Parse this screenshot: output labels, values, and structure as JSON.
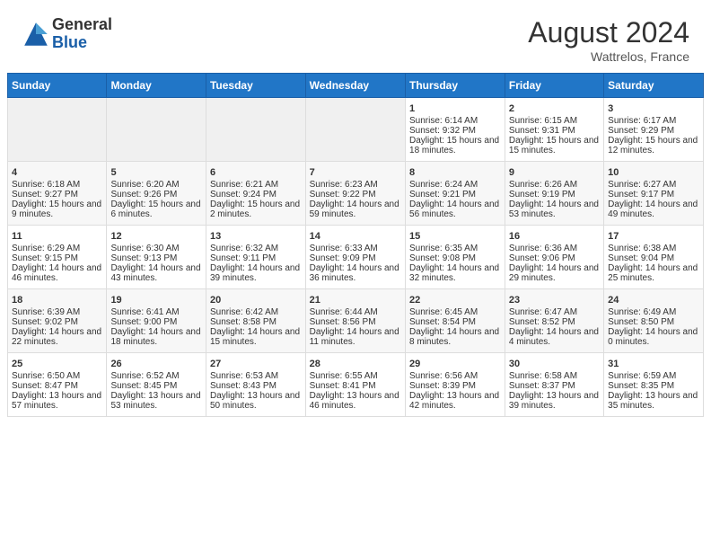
{
  "header": {
    "logo_general": "General",
    "logo_blue": "Blue",
    "month_year": "August 2024",
    "location": "Wattrelos, France"
  },
  "days_of_week": [
    "Sunday",
    "Monday",
    "Tuesday",
    "Wednesday",
    "Thursday",
    "Friday",
    "Saturday"
  ],
  "weeks": [
    [
      {
        "day": "",
        "empty": true
      },
      {
        "day": "",
        "empty": true
      },
      {
        "day": "",
        "empty": true
      },
      {
        "day": "",
        "empty": true
      },
      {
        "day": "1",
        "sunrise": "6:14 AM",
        "sunset": "9:32 PM",
        "daylight": "15 hours and 18 minutes."
      },
      {
        "day": "2",
        "sunrise": "6:15 AM",
        "sunset": "9:31 PM",
        "daylight": "15 hours and 15 minutes."
      },
      {
        "day": "3",
        "sunrise": "6:17 AM",
        "sunset": "9:29 PM",
        "daylight": "15 hours and 12 minutes."
      }
    ],
    [
      {
        "day": "4",
        "sunrise": "6:18 AM",
        "sunset": "9:27 PM",
        "daylight": "15 hours and 9 minutes."
      },
      {
        "day": "5",
        "sunrise": "6:20 AM",
        "sunset": "9:26 PM",
        "daylight": "15 hours and 6 minutes."
      },
      {
        "day": "6",
        "sunrise": "6:21 AM",
        "sunset": "9:24 PM",
        "daylight": "15 hours and 2 minutes."
      },
      {
        "day": "7",
        "sunrise": "6:23 AM",
        "sunset": "9:22 PM",
        "daylight": "14 hours and 59 minutes."
      },
      {
        "day": "8",
        "sunrise": "6:24 AM",
        "sunset": "9:21 PM",
        "daylight": "14 hours and 56 minutes."
      },
      {
        "day": "9",
        "sunrise": "6:26 AM",
        "sunset": "9:19 PM",
        "daylight": "14 hours and 53 minutes."
      },
      {
        "day": "10",
        "sunrise": "6:27 AM",
        "sunset": "9:17 PM",
        "daylight": "14 hours and 49 minutes."
      }
    ],
    [
      {
        "day": "11",
        "sunrise": "6:29 AM",
        "sunset": "9:15 PM",
        "daylight": "14 hours and 46 minutes."
      },
      {
        "day": "12",
        "sunrise": "6:30 AM",
        "sunset": "9:13 PM",
        "daylight": "14 hours and 43 minutes."
      },
      {
        "day": "13",
        "sunrise": "6:32 AM",
        "sunset": "9:11 PM",
        "daylight": "14 hours and 39 minutes."
      },
      {
        "day": "14",
        "sunrise": "6:33 AM",
        "sunset": "9:09 PM",
        "daylight": "14 hours and 36 minutes."
      },
      {
        "day": "15",
        "sunrise": "6:35 AM",
        "sunset": "9:08 PM",
        "daylight": "14 hours and 32 minutes."
      },
      {
        "day": "16",
        "sunrise": "6:36 AM",
        "sunset": "9:06 PM",
        "daylight": "14 hours and 29 minutes."
      },
      {
        "day": "17",
        "sunrise": "6:38 AM",
        "sunset": "9:04 PM",
        "daylight": "14 hours and 25 minutes."
      }
    ],
    [
      {
        "day": "18",
        "sunrise": "6:39 AM",
        "sunset": "9:02 PM",
        "daylight": "14 hours and 22 minutes."
      },
      {
        "day": "19",
        "sunrise": "6:41 AM",
        "sunset": "9:00 PM",
        "daylight": "14 hours and 18 minutes."
      },
      {
        "day": "20",
        "sunrise": "6:42 AM",
        "sunset": "8:58 PM",
        "daylight": "14 hours and 15 minutes."
      },
      {
        "day": "21",
        "sunrise": "6:44 AM",
        "sunset": "8:56 PM",
        "daylight": "14 hours and 11 minutes."
      },
      {
        "day": "22",
        "sunrise": "6:45 AM",
        "sunset": "8:54 PM",
        "daylight": "14 hours and 8 minutes."
      },
      {
        "day": "23",
        "sunrise": "6:47 AM",
        "sunset": "8:52 PM",
        "daylight": "14 hours and 4 minutes."
      },
      {
        "day": "24",
        "sunrise": "6:49 AM",
        "sunset": "8:50 PM",
        "daylight": "14 hours and 0 minutes."
      }
    ],
    [
      {
        "day": "25",
        "sunrise": "6:50 AM",
        "sunset": "8:47 PM",
        "daylight": "13 hours and 57 minutes."
      },
      {
        "day": "26",
        "sunrise": "6:52 AM",
        "sunset": "8:45 PM",
        "daylight": "13 hours and 53 minutes."
      },
      {
        "day": "27",
        "sunrise": "6:53 AM",
        "sunset": "8:43 PM",
        "daylight": "13 hours and 50 minutes."
      },
      {
        "day": "28",
        "sunrise": "6:55 AM",
        "sunset": "8:41 PM",
        "daylight": "13 hours and 46 minutes."
      },
      {
        "day": "29",
        "sunrise": "6:56 AM",
        "sunset": "8:39 PM",
        "daylight": "13 hours and 42 minutes."
      },
      {
        "day": "30",
        "sunrise": "6:58 AM",
        "sunset": "8:37 PM",
        "daylight": "13 hours and 39 minutes."
      },
      {
        "day": "31",
        "sunrise": "6:59 AM",
        "sunset": "8:35 PM",
        "daylight": "13 hours and 35 minutes."
      }
    ]
  ]
}
